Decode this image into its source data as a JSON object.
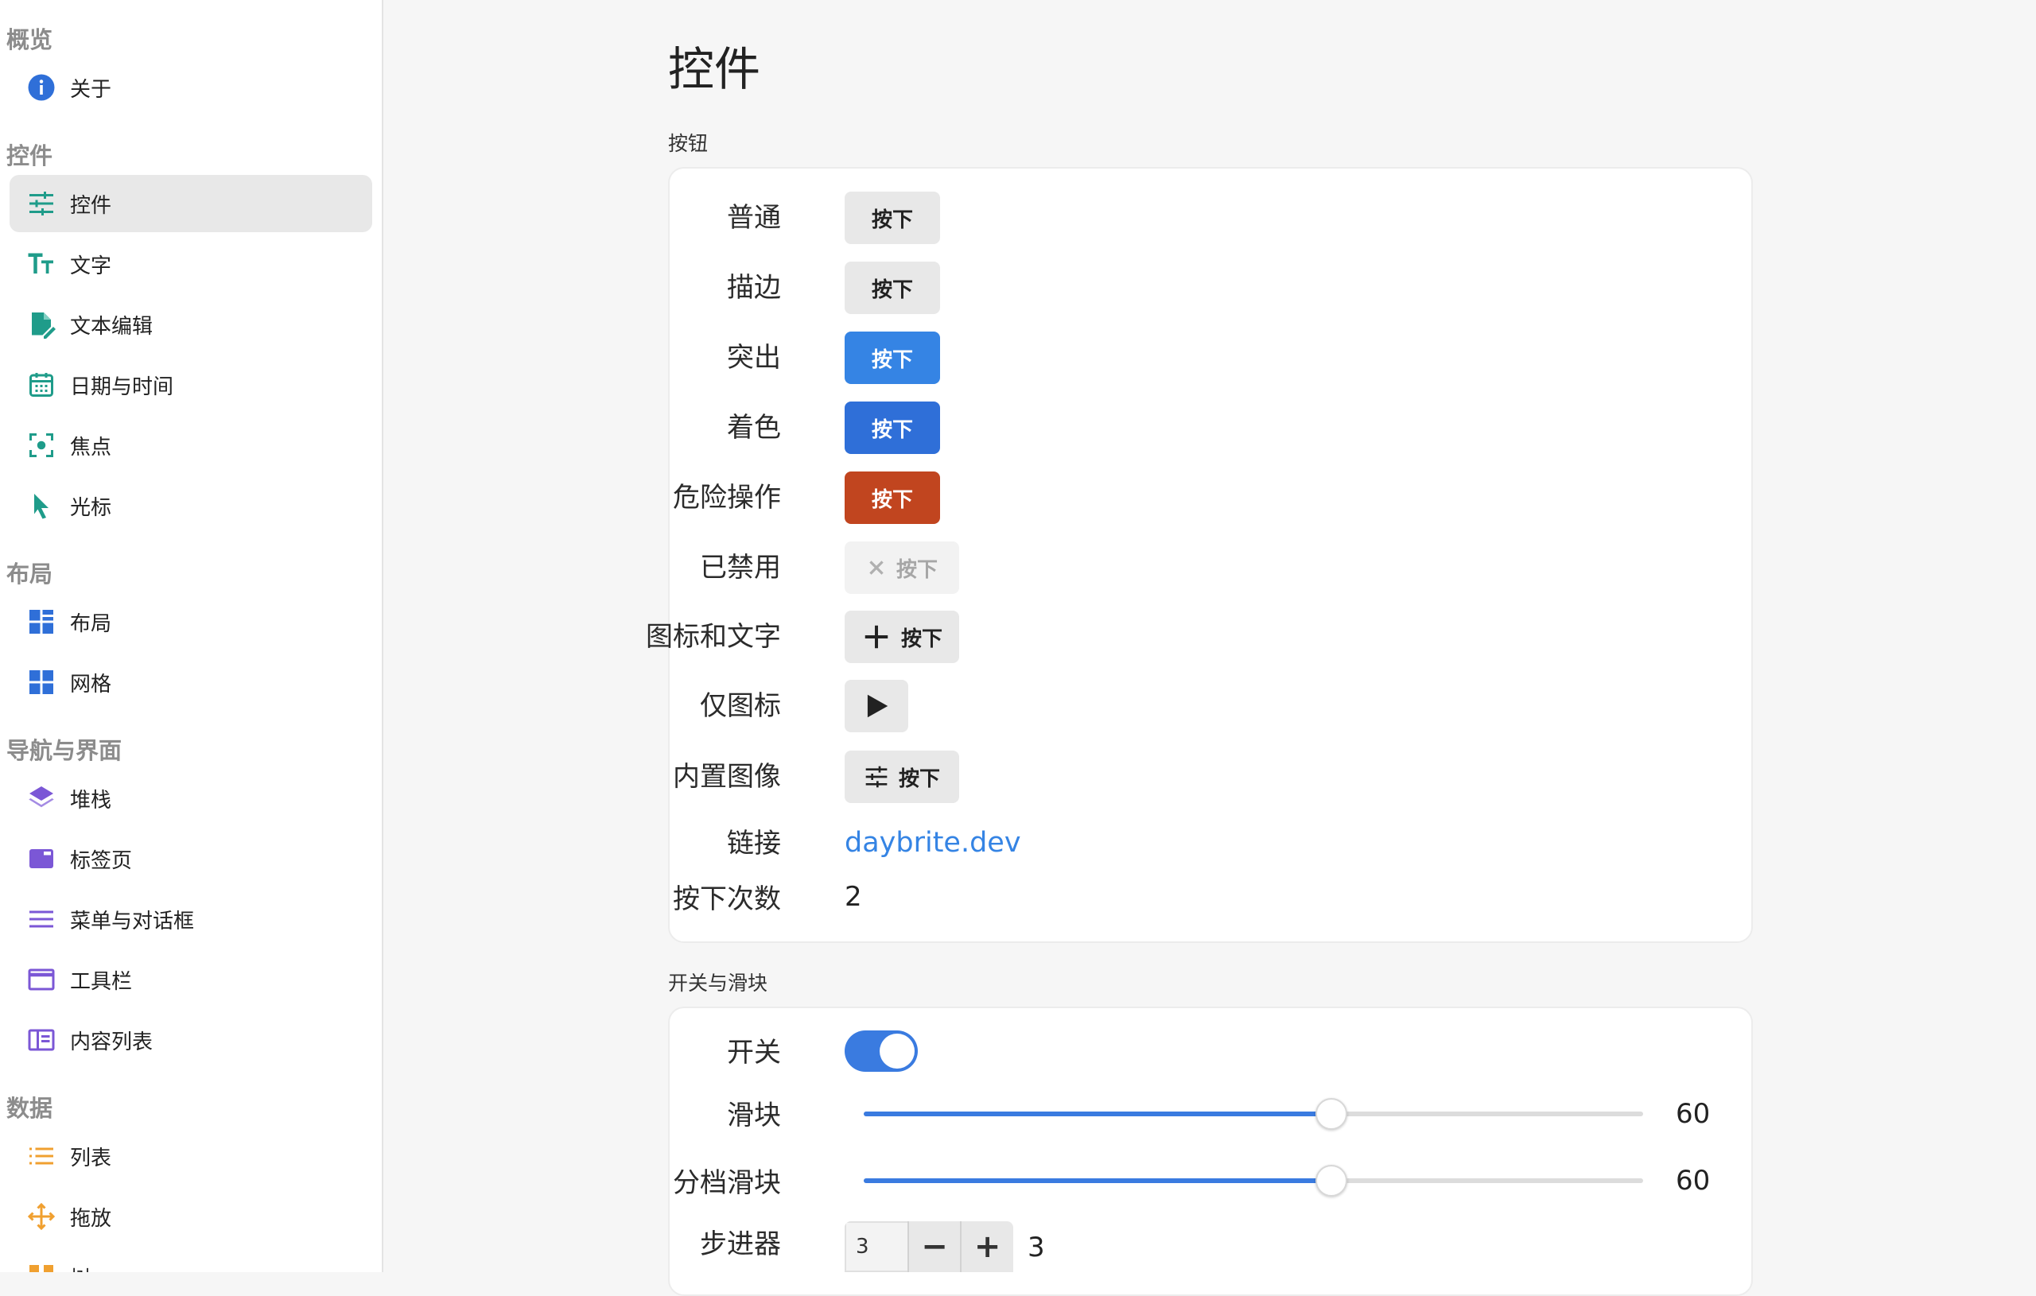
{
  "sidebar": {
    "sections": [
      {
        "title": "概览",
        "items": [
          {
            "label": "关于"
          }
        ]
      },
      {
        "title": "控件",
        "items": [
          {
            "label": "控件"
          },
          {
            "label": "文字"
          },
          {
            "label": "文本编辑"
          },
          {
            "label": "日期与时间"
          },
          {
            "label": "焦点"
          },
          {
            "label": "光标"
          }
        ]
      },
      {
        "title": "布局",
        "items": [
          {
            "label": "布局"
          },
          {
            "label": "网格"
          }
        ]
      },
      {
        "title": "导航与界面",
        "items": [
          {
            "label": "堆栈"
          },
          {
            "label": "标签页"
          },
          {
            "label": "菜单与对话框"
          },
          {
            "label": "工具栏"
          },
          {
            "label": "内容列表"
          }
        ]
      },
      {
        "title": "数据",
        "items": [
          {
            "label": "列表"
          },
          {
            "label": "拖放"
          },
          {
            "label": "树"
          }
        ]
      }
    ],
    "selected": "控件",
    "colors": {
      "teal": "#1f9c8a",
      "blue": "#2f6fd8",
      "purple": "#7b57d6",
      "orange": "#f0a030"
    }
  },
  "main": {
    "title": "控件",
    "buttons_group": {
      "title": "按钮",
      "rows": {
        "normal": {
          "label": "普通",
          "button": "按下"
        },
        "outline": {
          "label": "描边",
          "button": "按下"
        },
        "suggested": {
          "label": "突出",
          "button": "按下"
        },
        "accent": {
          "label": "着色",
          "button": "按下"
        },
        "destructive": {
          "label": "危险操作",
          "button": "按下"
        },
        "disabled": {
          "label": "已禁用",
          "button": "按下",
          "icon": "close-icon"
        },
        "icon_text": {
          "label": "图标和文字",
          "button": "按下",
          "icon": "plus-icon"
        },
        "icon_only": {
          "label": "仅图标",
          "icon": "play-icon"
        },
        "builtin_image": {
          "label": "内置图像",
          "button": "按下",
          "icon": "sliders-icon"
        },
        "link": {
          "label": "链接",
          "text": "daybrite.dev"
        },
        "press_count": {
          "label": "按下次数",
          "value": "2"
        }
      }
    },
    "switches_group": {
      "title": "开关与滑块",
      "switch": {
        "label": "开关",
        "on": true
      },
      "slider": {
        "label": "滑块",
        "value": 60,
        "display": "60",
        "min": 0,
        "max": 100
      },
      "stepped_slider": {
        "label": "分档滑块",
        "value": 60,
        "display": "60",
        "min": 0,
        "max": 100
      },
      "stepper": {
        "label": "步进器",
        "input": "3",
        "minus": "−",
        "plus": "+",
        "value": "3"
      }
    }
  }
}
